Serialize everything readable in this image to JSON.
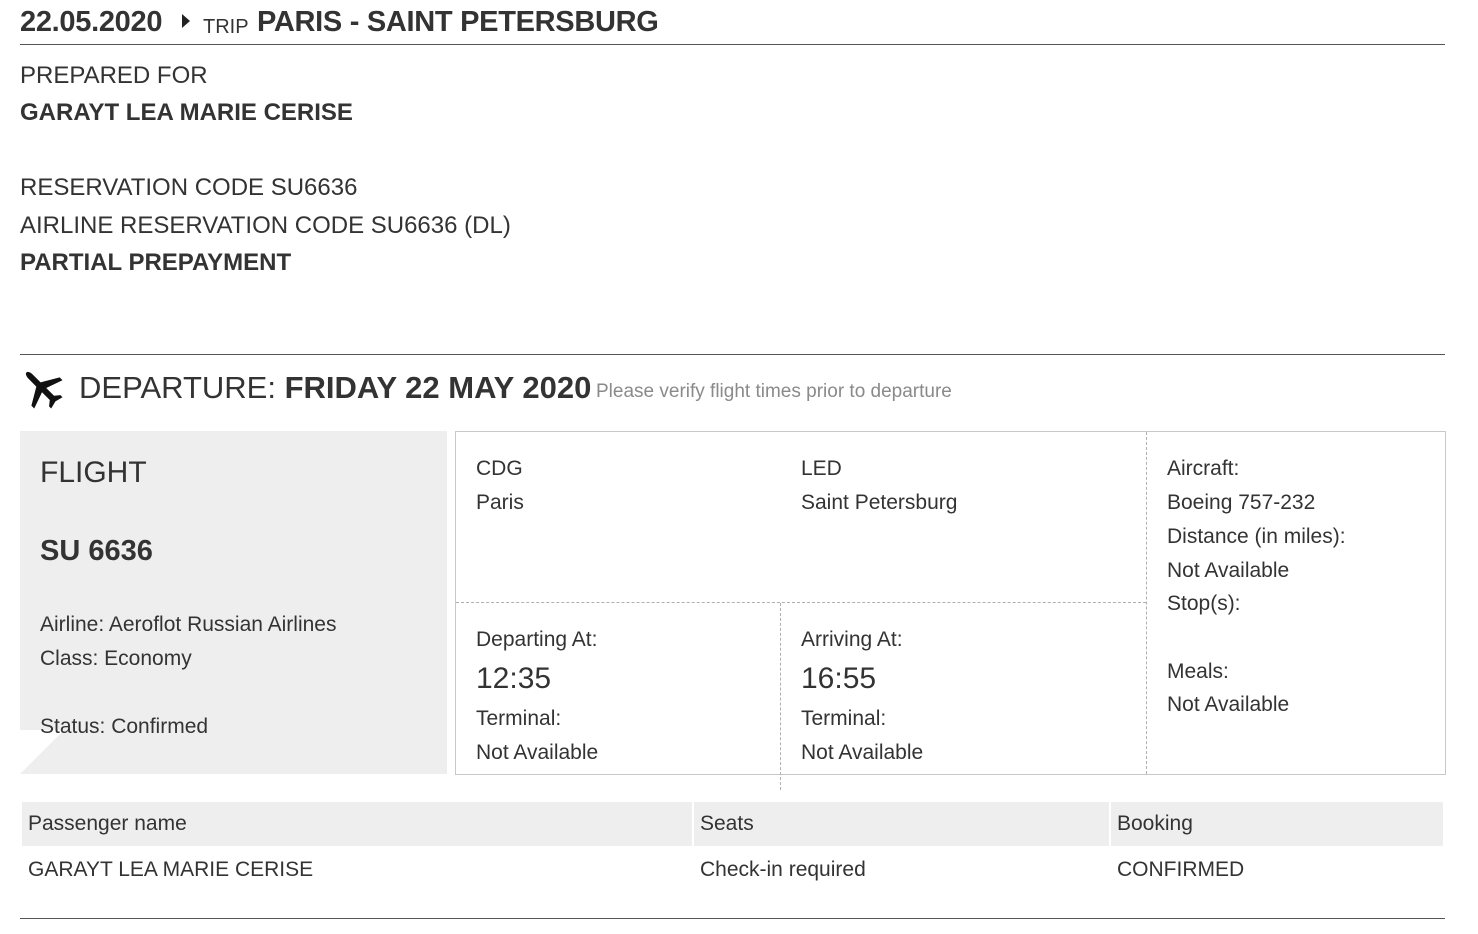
{
  "header": {
    "date": "22.05.2020",
    "trip_label": "TRIP",
    "route": "PARIS - SAINT PETERSBURG"
  },
  "info": {
    "prepared_for_label": "PREPARED FOR",
    "passenger": "GARAYT LEA MARIE CERISE",
    "reservation_code": "RESERVATION CODE SU6636",
    "airline_reservation_code": "AIRLINE RESERVATION CODE SU6636 (DL)",
    "payment_status": "PARTIAL PREPAYMENT"
  },
  "departure": {
    "label": "DEPARTURE:",
    "date": "FRIDAY 22 MAY 2020",
    "note": "Please verify flight times prior to departure",
    "icon": "airplane-icon"
  },
  "flight": {
    "title": "FLIGHT",
    "number": "SU 6636",
    "airline": "Airline: Aeroflot Russian Airlines",
    "class": "Class: Economy",
    "status": "Status: Confirmed"
  },
  "route": {
    "origin_code": "CDG",
    "origin_city": "Paris",
    "dest_code": "LED",
    "dest_city": "Saint Petersburg",
    "departing_label": "Departing At:",
    "departing_time": "12:35",
    "departing_terminal_label": "Terminal:",
    "departing_terminal": "Not Available",
    "arriving_label": "Arriving At:",
    "arriving_time": "16:55",
    "arriving_terminal_label": "Terminal:",
    "arriving_terminal": "Not Available"
  },
  "aircraft": {
    "aircraft_label": "Aircraft:",
    "aircraft_value": "Boeing 757-232",
    "distance_label": "Distance (in miles):",
    "distance_value": "Not Available",
    "stops_label": "Stop(s):",
    "meals_label": "Meals:",
    "meals_value": "Not Available"
  },
  "passengers_table": {
    "headers": [
      "Passenger name",
      "Seats",
      "Booking"
    ],
    "rows": [
      [
        "GARAYT LEA MARIE CERISE",
        "Check-in required",
        "CONFIRMED"
      ]
    ]
  }
}
